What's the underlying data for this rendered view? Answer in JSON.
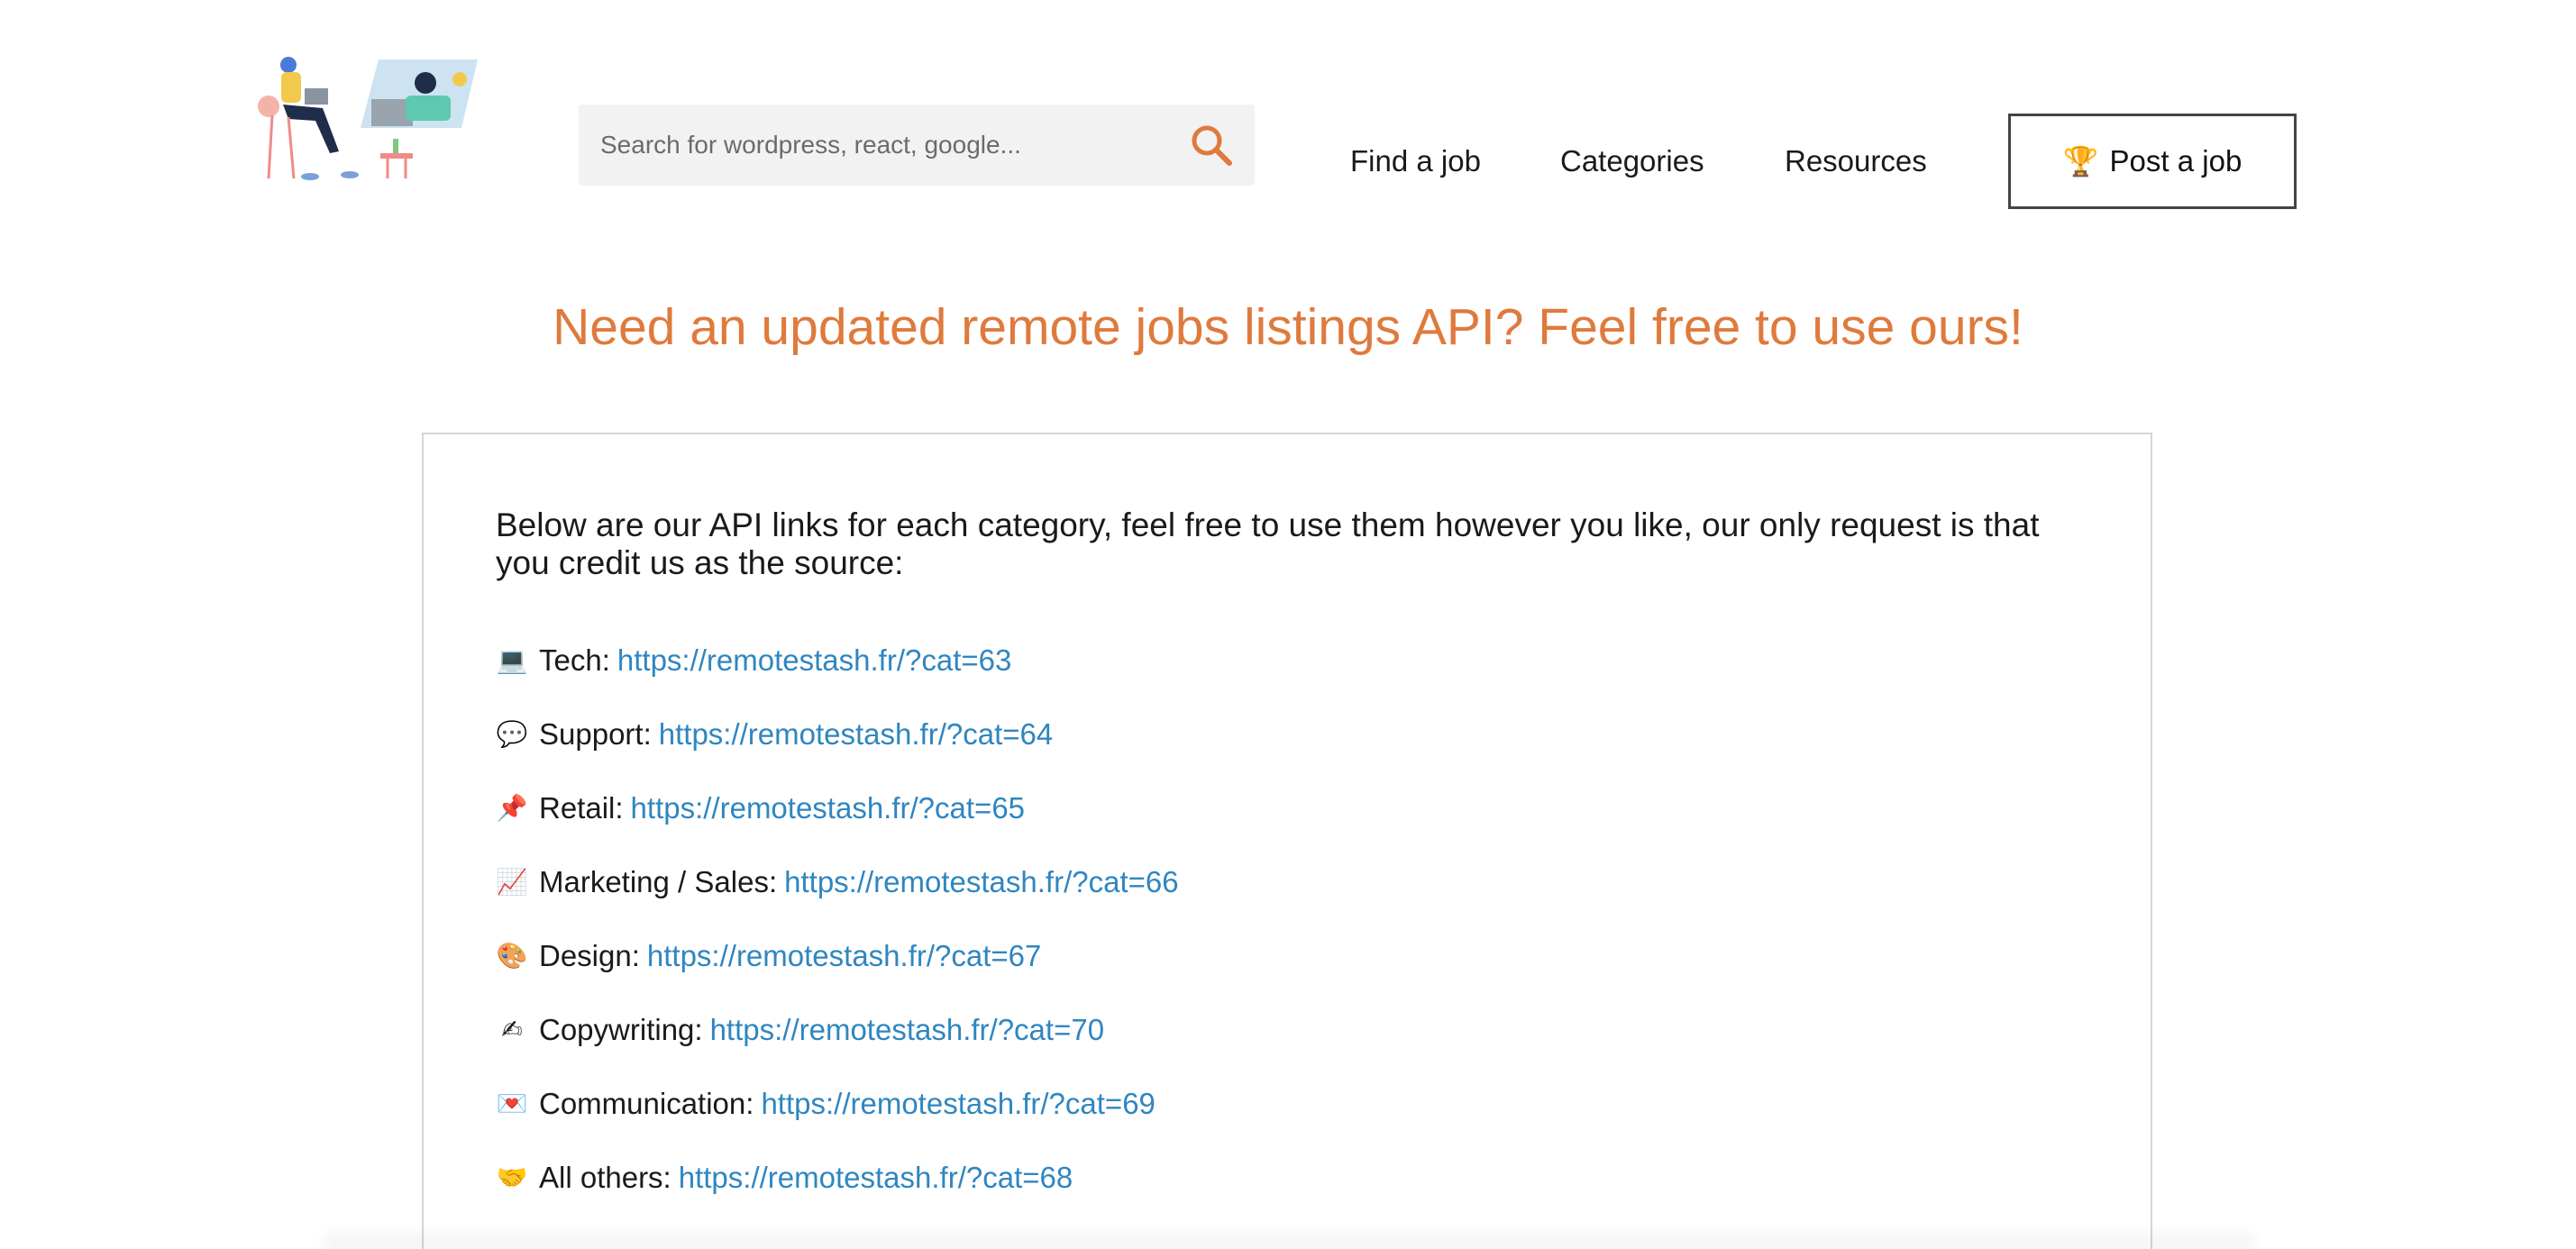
{
  "header": {
    "search": {
      "placeholder": "Search for wordpress, react, google..."
    },
    "nav": [
      {
        "label": "Find a job"
      },
      {
        "label": "Categories"
      },
      {
        "label": "Resources"
      }
    ],
    "post_button": {
      "icon": "trophy-icon",
      "label": "Post a job"
    }
  },
  "headline": "Need an updated remote jobs listings API? Feel free to use ours!",
  "card": {
    "intro": "Below are our API links for each category, feel free to use them however you like, our only request is that you credit us as the source:",
    "items": [
      {
        "icon": "laptop-icon",
        "glyph": "💻",
        "label": "Tech:",
        "url": "https://remotestash.fr/?cat=63"
      },
      {
        "icon": "speech-bubble-icon",
        "glyph": "💬",
        "label": "Support:",
        "url": "https://remotestash.fr/?cat=64"
      },
      {
        "icon": "pushpin-icon",
        "glyph": "📌",
        "label": "Retail:",
        "url": "https://remotestash.fr/?cat=65"
      },
      {
        "icon": "chart-increasing-icon",
        "glyph": "📈",
        "label": "Marketing / Sales:",
        "url": "https://remotestash.fr/?cat=66"
      },
      {
        "icon": "palette-icon",
        "glyph": "🎨",
        "label": "Design:",
        "url": "https://remotestash.fr/?cat=67"
      },
      {
        "icon": "writing-hand-icon",
        "glyph": "✍",
        "label": "Copywriting:",
        "url": "https://remotestash.fr/?cat=70"
      },
      {
        "icon": "love-letter-icon",
        "glyph": "💌",
        "label": "Communication:",
        "url": "https://remotestash.fr/?cat=69"
      },
      {
        "icon": "handshake-icon",
        "glyph": "🤝",
        "label": "All others:",
        "url": "https://remotestash.fr/?cat=68"
      }
    ]
  },
  "colors": {
    "accent": "#df7a3d",
    "link": "#2f86c0",
    "search_bg": "#f2f2f2"
  }
}
